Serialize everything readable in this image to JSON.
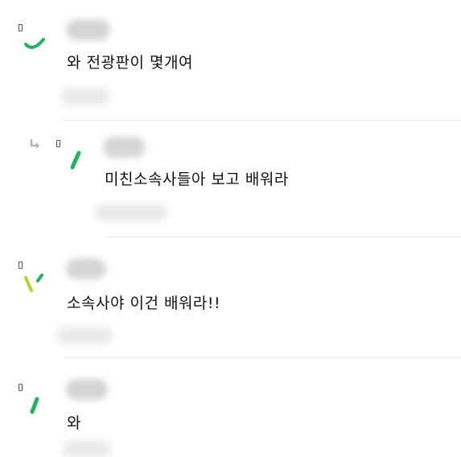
{
  "comments": [
    {
      "text": "와 전광판이 몇개여",
      "is_reply": false
    },
    {
      "text": "미친소속사들아 보고 배워라",
      "is_reply": true
    },
    {
      "text": "소속사야 이건 배워라!!",
      "is_reply": false
    },
    {
      "text": "와",
      "is_reply": false
    }
  ],
  "colors": {
    "accent_green": "#1fb45a",
    "accent_lime": "#b9d22b",
    "divider": "#ececec",
    "reply_icon": "#b5b5b5"
  },
  "icons": {
    "badge": "badge-icon",
    "reply": "reply-arrow-icon"
  }
}
